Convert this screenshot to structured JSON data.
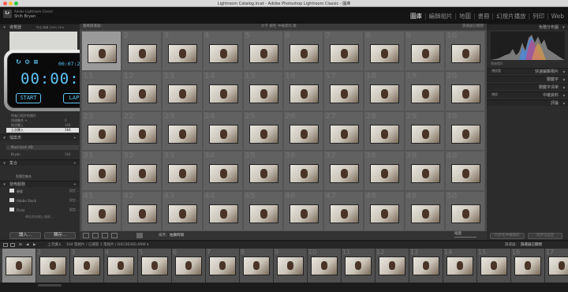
{
  "window": {
    "title": "Lightroom Catalog.lrcat - Adobe Photoshop Lightroom Classic - 圖庫",
    "traffic_colors": [
      "#fc5f57",
      "#fdbc2e",
      "#28c840"
    ]
  },
  "identity": {
    "logo": "Lr",
    "product": "Adobe Lightroom Classic",
    "user": "Shih Bryan"
  },
  "modules": [
    "圖庫",
    "編輯相片",
    "地圖",
    "書冊",
    "幻燈片播放",
    "列印",
    "Web"
  ],
  "left_panel": {
    "navigator": {
      "label": "導覽器",
      "zoom": [
        "符合",
        "填滿",
        "100%",
        "25%"
      ]
    },
    "catalog_rows": [
      {
        "label": "所有已同步的相片",
        "count": ""
      },
      {
        "label": "快速集合 +",
        "count": "0"
      },
      {
        "label": "前次匯入",
        "count": "164"
      },
      {
        "label": "上次匯入",
        "count": "164"
      }
    ],
    "folders_header": "檔案夾",
    "volume": {
      "label": "Macintosh HD",
      "count": ""
    },
    "folder": {
      "label": "Bryan",
      "count": "164"
    },
    "collections_header": "集合",
    "collection": "智慧型集合",
    "publish_header": "發佈服務",
    "publish_items": [
      {
        "label": "硬碟",
        "action": "設定..."
      },
      {
        "label": "Adobe Stock",
        "action": "設定..."
      },
      {
        "label": "Flickr",
        "action": "設定..."
      }
    ],
    "find_more": "尋找其他線上服務...",
    "import_button": "讀入...",
    "export_button": "轉存..."
  },
  "stopwatch": {
    "split_time": "00:07:21.8",
    "main_time": "00:00:07",
    "main_fraction": ".8",
    "start_label": "START",
    "lap_label": "LAP"
  },
  "filter_bar": {
    "label": "圖庫篩選器：",
    "options": "文字  屬性  中繼資料  無",
    "preset": "篩選器已關閉"
  },
  "grid_numbers": [
    "",
    "2",
    "3",
    "4",
    "5",
    "6",
    "7",
    "8",
    "9",
    "10",
    "11",
    "12",
    "13",
    "14",
    "15",
    "16",
    "17",
    "18",
    "19",
    "20",
    "21",
    "22",
    "23",
    "24",
    "25",
    "26",
    "27",
    "28",
    "29",
    "30",
    "31",
    "32",
    "33",
    "34",
    "35",
    "36",
    "37",
    "38",
    "39",
    "40",
    "41",
    "42",
    "43",
    "44",
    "45",
    "46",
    "47",
    "48",
    "49",
    "50"
  ],
  "toolbar": {
    "sort_label": "排序：",
    "sort_value": "拍攝時間",
    "thumb_label": "縮圖"
  },
  "right_panel": {
    "histogram_label": "色階分布圖",
    "original_photo": "原始相片",
    "quick_develop": "快速編輯相片",
    "saved_preset": "預設值",
    "keywords": "關鍵字",
    "keyword_list": "關鍵字清單",
    "metadata": "中繼資料",
    "metadata_preset": "預設",
    "comments": "評論",
    "sync_metadata": "同步化中繼資料",
    "sync_settings": "同步化設定"
  },
  "filmstrip_bar": {
    "source": "上次讀入",
    "info": "164 張相片 / 已選取 1 張相片 / DSC06360.ARW ▾",
    "filter_label": "篩選器：",
    "filter_value": "篩選器已關閉"
  },
  "filmstrip_numbers": [
    "",
    "2",
    "3",
    "4",
    "5",
    "6",
    "7",
    "8",
    "9",
    "10",
    "11",
    "12",
    "13",
    "14",
    "15",
    "16",
    "17"
  ]
}
